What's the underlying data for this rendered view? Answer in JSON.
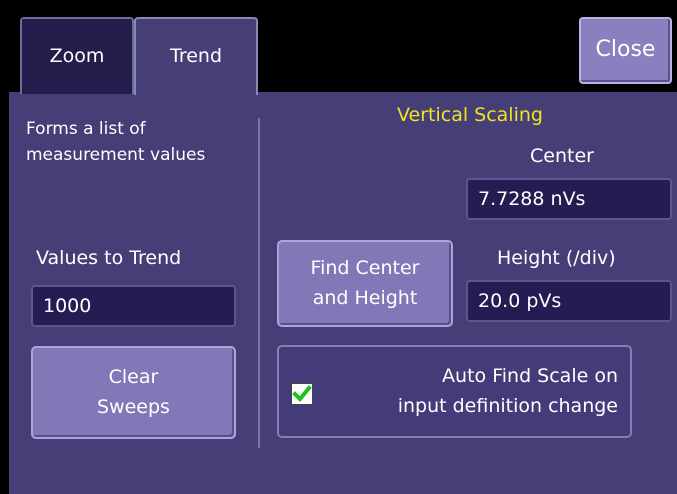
{
  "tabs": [
    {
      "label": "Zoom",
      "active": false
    },
    {
      "label": "Trend",
      "active": true
    }
  ],
  "close_label": "Close",
  "description": [
    "Forms a list of",
    "measurement values"
  ],
  "values_to_trend": {
    "label": "Values to Trend",
    "value": "1000"
  },
  "clear_sweeps_label": [
    "Clear",
    "Sweeps"
  ],
  "vertical_scaling": {
    "title": "Vertical Scaling",
    "center_label": "Center",
    "center_value": "7.7288 nVs",
    "height_label": "Height (/div)",
    "height_value": "20.0 pVs",
    "find_button": [
      "Find Center",
      "and Height"
    ]
  },
  "auto_find": {
    "label": [
      "Auto Find Scale on",
      "input definition change"
    ],
    "checked": true
  },
  "colors": {
    "panel": "#463f77",
    "accent_title": "#f2e21f",
    "check": "#1fc21f",
    "button": "#8178b8"
  }
}
